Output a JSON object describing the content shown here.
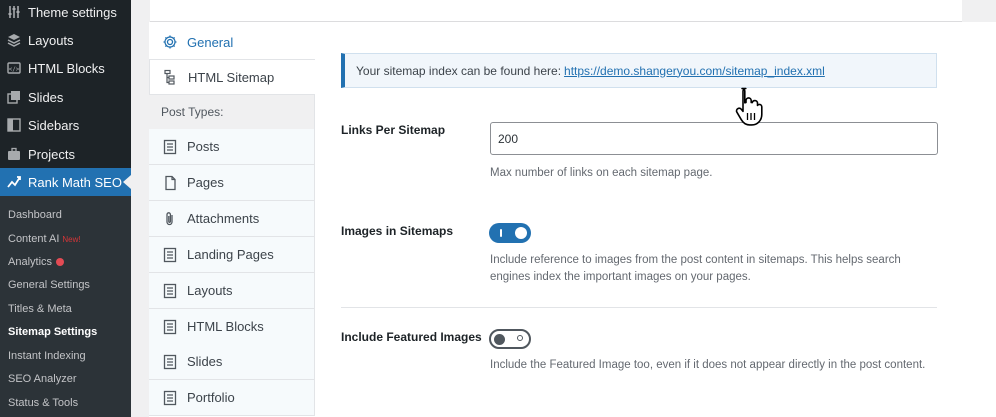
{
  "wp_menu": [
    {
      "label": "Theme settings",
      "icon": "sliders-icon"
    },
    {
      "label": "Layouts",
      "icon": "layers-icon"
    },
    {
      "label": "HTML Blocks",
      "icon": "code-block-icon"
    },
    {
      "label": "Slides",
      "icon": "slides-icon"
    },
    {
      "label": "Sidebars",
      "icon": "sidebar-icon"
    },
    {
      "label": "Projects",
      "icon": "briefcase-icon"
    },
    {
      "label": "Rank Math SEO",
      "icon": "rank-math-icon"
    }
  ],
  "submenu": [
    {
      "label": "Dashboard"
    },
    {
      "label": "Content AI",
      "badge": "New!"
    },
    {
      "label": "Analytics"
    },
    {
      "label": "General Settings"
    },
    {
      "label": "Titles & Meta"
    },
    {
      "label": "Sitemap Settings"
    },
    {
      "label": "Instant Indexing"
    },
    {
      "label": "SEO Analyzer"
    },
    {
      "label": "Status & Tools"
    }
  ],
  "tabs": {
    "general": "General",
    "html_sitemap": "HTML Sitemap",
    "post_types_header": "Post Types:",
    "items": [
      "Posts",
      "Pages",
      "Attachments",
      "Landing Pages",
      "Layouts",
      "HTML Blocks",
      "Slides",
      "Portfolio"
    ]
  },
  "notice": {
    "text": "Your sitemap index can be found here:",
    "link": "https://demo.shangeryou.com/sitemap_index.xml"
  },
  "links_per_sitemap": {
    "label": "Links Per Sitemap",
    "value": "200",
    "description": "Max number of links on each sitemap page."
  },
  "images_in_sitemaps": {
    "label": "Images in Sitemaps",
    "enabled": true,
    "description": "Include reference to images from the post content in sitemaps. This helps search engines index the important images on your pages."
  },
  "include_featured_images": {
    "label": "Include Featured Images",
    "enabled": false,
    "description": "Include the Featured Image too, even if it does not appear directly in the post content."
  },
  "colors": {
    "accent": "#2271b1",
    "sidebar": "#1d2327"
  }
}
